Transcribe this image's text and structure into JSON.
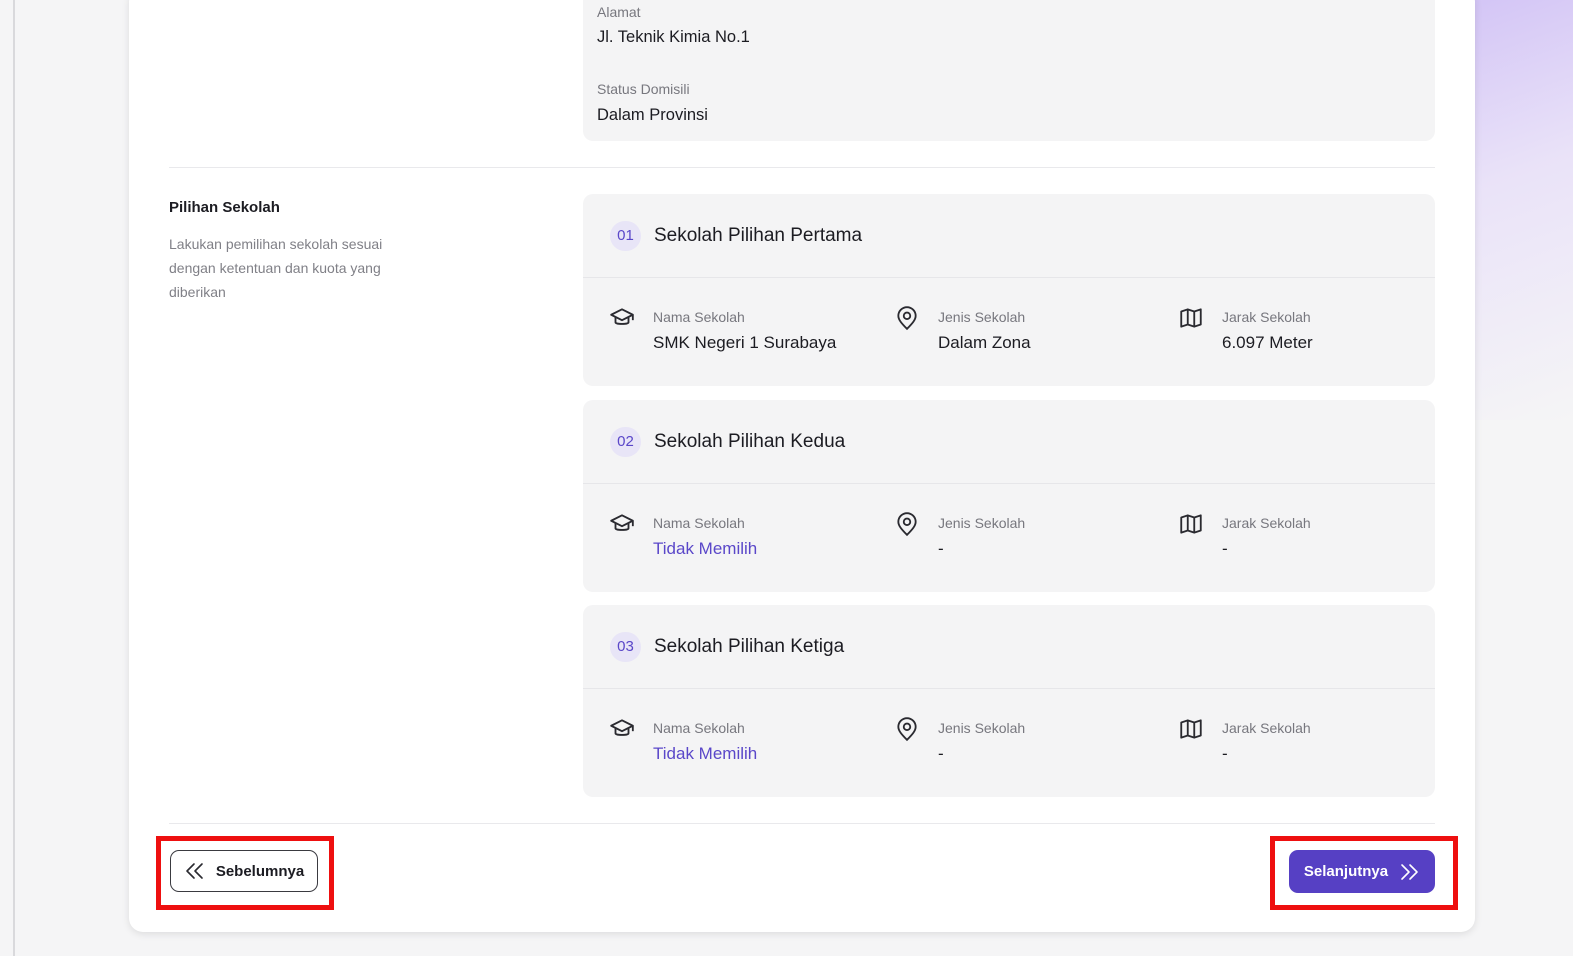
{
  "domicile": {
    "address_label": "Alamat",
    "address_value": "Jl. Teknik Kimia No.1",
    "status_label": "Status Domisili",
    "status_value": "Dalam Provinsi"
  },
  "school_section": {
    "title": "Pilihan Sekolah",
    "description": "Lakukan pemilihan sekolah sesuai dengan ketentuan dan kuota yang diberikan"
  },
  "choices": [
    {
      "number": "01",
      "title": "Sekolah Pilihan Pertama",
      "school_name_label": "Nama Sekolah",
      "school_name_value": "SMK Negeri 1 Surabaya",
      "school_type_label": "Jenis Sekolah",
      "school_type_value": "Dalam Zona",
      "distance_label": "Jarak Sekolah",
      "distance_value": "6.097 Meter"
    },
    {
      "number": "02",
      "title": "Sekolah Pilihan Kedua",
      "school_name_label": "Nama Sekolah",
      "school_name_value": "Tidak Memilih",
      "school_type_label": "Jenis Sekolah",
      "school_type_value": "-",
      "distance_label": "Jarak Sekolah",
      "distance_value": "-"
    },
    {
      "number": "03",
      "title": "Sekolah Pilihan Ketiga",
      "school_name_label": "Nama Sekolah",
      "school_name_value": "Tidak Memilih",
      "school_type_label": "Jenis Sekolah",
      "school_type_value": "-",
      "distance_label": "Jarak Sekolah",
      "distance_value": "-"
    }
  ],
  "nav": {
    "prev_label": "Sebelumnya",
    "next_label": "Selanjutnya"
  },
  "colors": {
    "accent": "#5640c4",
    "highlight": "#ee0f0f"
  },
  "icons": {
    "school_name": "graduation-cap-icon",
    "school_type": "map-pin-icon",
    "distance": "map-icon",
    "prev": "double-chevron-left-icon",
    "next": "double-chevron-right-icon"
  }
}
